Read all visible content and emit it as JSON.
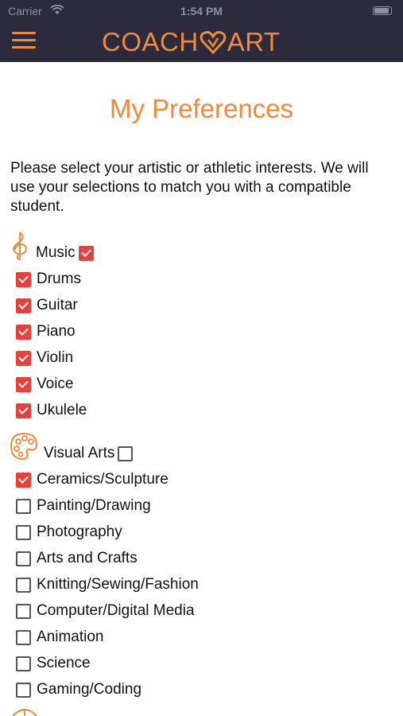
{
  "status_bar": {
    "carrier": "Carrier",
    "time": "1:54 PM"
  },
  "header": {
    "logo_left": "COACH",
    "logo_right": "ART"
  },
  "page": {
    "title": "My Preferences",
    "intro": "Please select your artistic or athletic interests. We will use your selections to match you with a compatible student."
  },
  "colors": {
    "accent": "#f08a3a",
    "header_bg": "#2c2a3d",
    "checkbox_checked": "#e8413c"
  },
  "categories": [
    {
      "name": "Music",
      "icon": "treble-clef-icon",
      "checked": true,
      "options": [
        {
          "label": "Drums",
          "checked": true
        },
        {
          "label": "Guitar",
          "checked": true
        },
        {
          "label": "Piano",
          "checked": true
        },
        {
          "label": "Violin",
          "checked": true
        },
        {
          "label": "Voice",
          "checked": true
        },
        {
          "label": "Ukulele",
          "checked": true
        }
      ]
    },
    {
      "name": "Visual Arts",
      "icon": "palette-icon",
      "checked": false,
      "options": [
        {
          "label": "Ceramics/Sculpture",
          "checked": true
        },
        {
          "label": "Painting/Drawing",
          "checked": false
        },
        {
          "label": "Photography",
          "checked": false
        },
        {
          "label": "Arts and Crafts",
          "checked": false
        },
        {
          "label": "Knitting/Sewing/Fashion",
          "checked": false
        },
        {
          "label": "Computer/Digital Media",
          "checked": false
        },
        {
          "label": "Animation",
          "checked": false
        },
        {
          "label": "Science",
          "checked": false
        },
        {
          "label": "Gaming/Coding",
          "checked": false
        }
      ]
    }
  ]
}
